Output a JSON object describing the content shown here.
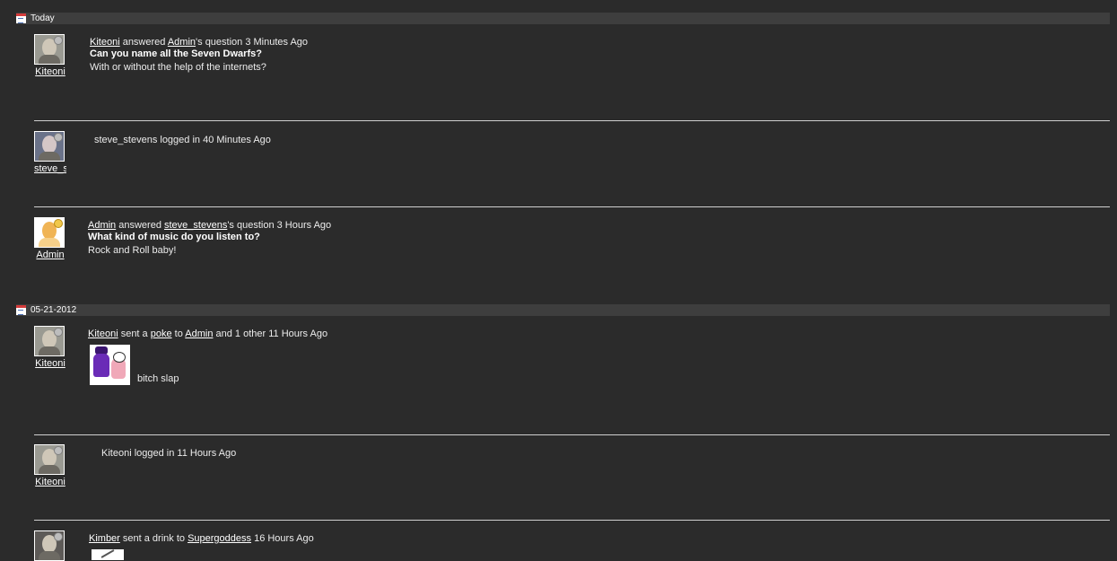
{
  "sections": [
    {
      "date": "Today"
    },
    {
      "date": "05-21-2012"
    }
  ],
  "entries": [
    {
      "user": "Kiteoni",
      "actor": "Kiteoni",
      "verb": " answered ",
      "target": "Admin",
      "suffix": "'s question 3 Minutes Ago",
      "question": "Can you name all the Seven Dwarfs?",
      "answer": "With or without the help of the internets?"
    },
    {
      "user": "steve_stevens",
      "text": "steve_stevens logged in 40 Minutes Ago"
    },
    {
      "user": "Admin",
      "actor": "Admin",
      "verb": " answered ",
      "target": "steve_stevens",
      "suffix": "'s question 3 Hours Ago",
      "question": "What kind of music do you listen to?",
      "answer": "Rock and Roll baby!"
    },
    {
      "user": "Kiteoni",
      "actor": "Kiteoni",
      "verb": " sent a ",
      "object": "poke",
      "mid": " to ",
      "target": "Admin",
      "suffix": " and 1 other 11 Hours Ago",
      "caption": "bitch slap"
    },
    {
      "user": "Kiteoni",
      "text": "Kiteoni logged in 11 Hours Ago"
    },
    {
      "actor": "Kimber",
      "verb": " sent a drink to ",
      "target": "Supergoddess",
      "suffix": " 16 Hours Ago"
    }
  ],
  "icons": {
    "calendar": "calendar-icon",
    "status": "status-indicator-icon"
  },
  "colors": {
    "background": "#2b2b2b",
    "date_bar": "#3e3e3e",
    "divider": "#cfcfcf",
    "online": "#f1c84b"
  }
}
